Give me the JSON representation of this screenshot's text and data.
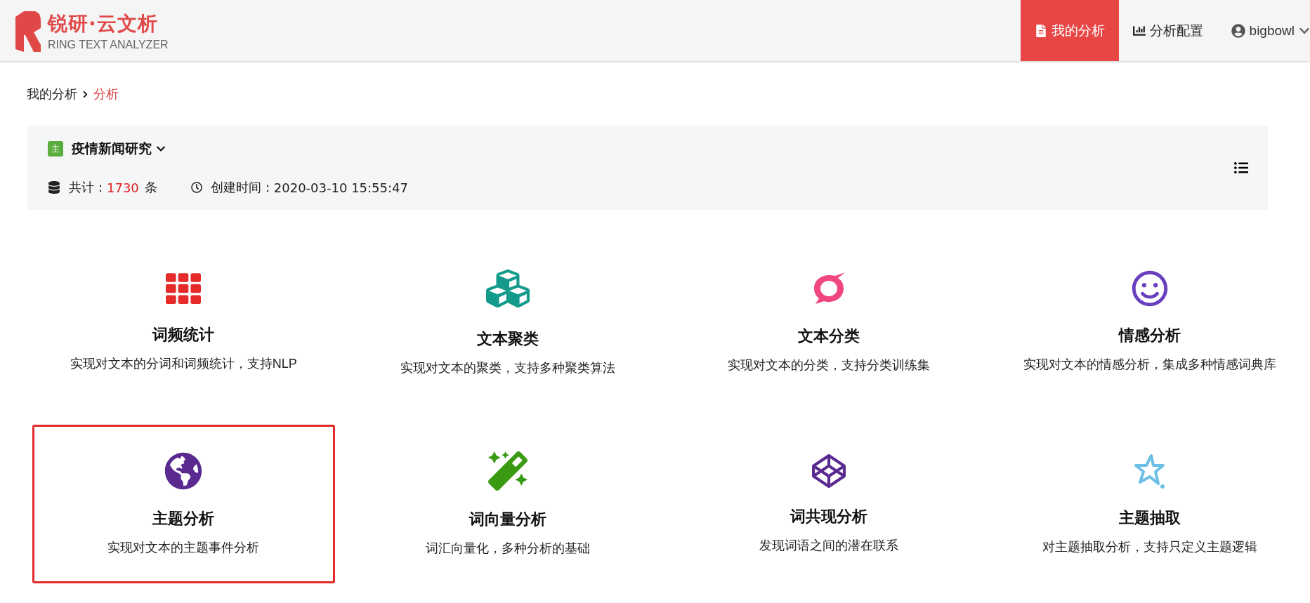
{
  "brand": {
    "title": "锐研·云文析",
    "subtitle": "RING TEXT ANALYZER"
  },
  "nav": [
    {
      "kind": "file",
      "label": "我的分析",
      "selected": true
    },
    {
      "kind": "chart",
      "label": "分析配置",
      "selected": false
    }
  ],
  "user": {
    "name": "bigbowl"
  },
  "breadcrumb": [
    {
      "label": "我的分析",
      "selected": false
    },
    {
      "label": "分析",
      "selected": true
    }
  ],
  "project": {
    "badge": "主",
    "name": "疫情新闻研究",
    "count_label": "共计：",
    "count": "1730",
    "count_unit": "条",
    "created_label": "创建时间：",
    "created": "2020-03-10 15:55:47"
  },
  "cards": [
    {
      "kind": "grid",
      "title": "词频统计",
      "description": "实现对文本的分词和词频统计，支持NLP",
      "selected": false
    },
    {
      "kind": "cubes",
      "title": "文本聚类",
      "description": "实现对文本的聚类，支持多种聚类算法",
      "selected": false
    },
    {
      "kind": "bubble",
      "title": "文本分类",
      "description": "实现对文本的分类，支持分类训练集",
      "selected": false
    },
    {
      "kind": "smile",
      "title": "情感分析",
      "description": "实现对文本的情感分析，集成多种情感词典库",
      "selected": false
    },
    {
      "kind": "globe",
      "title": "主题分析",
      "description": "实现对文本的主题事件分析",
      "selected": true
    },
    {
      "kind": "wand",
      "title": "词向量分析",
      "description": "词汇向量化，多种分析的基础",
      "selected": false
    },
    {
      "kind": "cube",
      "title": "词共现分析",
      "description": "发现词语之间的潜在联系",
      "selected": false
    },
    {
      "kind": "star",
      "title": "主题抽取",
      "description": "对主题抽取分析，支持只定义主题逻辑",
      "selected": false
    }
  ]
}
